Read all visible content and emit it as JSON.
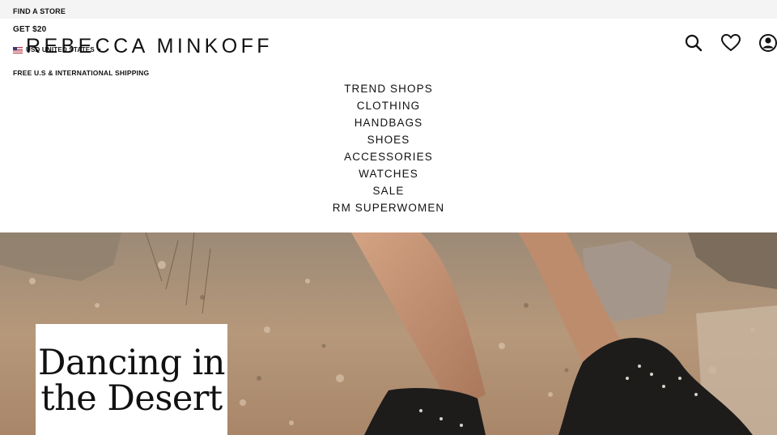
{
  "topbar": {
    "find_store": "FIND A STORE"
  },
  "utility": {
    "promo": "GET $20",
    "locale": "USD UNITED STATES",
    "shipping": "FREE U.S & INTERNATIONAL SHIPPING"
  },
  "brand": {
    "logo_text": "REBECCA MINKOFF"
  },
  "header_icons": [
    {
      "name": "search-icon"
    },
    {
      "name": "heart-icon"
    },
    {
      "name": "account-icon"
    }
  ],
  "nav": {
    "items": [
      {
        "label": "TREND SHOPS"
      },
      {
        "label": "CLOTHING"
      },
      {
        "label": "HANDBAGS"
      },
      {
        "label": "SHOES"
      },
      {
        "label": "ACCESSORIES"
      },
      {
        "label": "WATCHES"
      },
      {
        "label": "SALE"
      },
      {
        "label": "RM SUPERWOMEN"
      }
    ]
  },
  "hero": {
    "headline": "Dancing in the Desert",
    "colors": {
      "ground": "#b29274",
      "rock": "#8a7561",
      "leg": "#c49273",
      "boot": "#1d1c1b"
    }
  }
}
